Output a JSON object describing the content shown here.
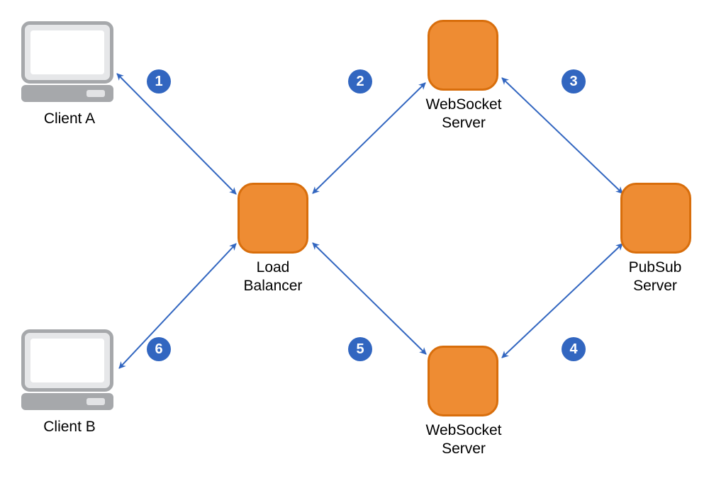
{
  "nodes": {
    "clientA": {
      "label": "Client A"
    },
    "clientB": {
      "label": "Client B"
    },
    "loadBalancer": {
      "label": "Load\nBalancer"
    },
    "wsTop": {
      "label": "WebSocket\nServer"
    },
    "wsBottom": {
      "label": "WebSocket\nServer"
    },
    "pubsub": {
      "label": "PubSub\nServer"
    }
  },
  "steps": {
    "s1": "1",
    "s2": "2",
    "s3": "3",
    "s4": "4",
    "s5": "5",
    "s6": "6"
  },
  "connections": [
    {
      "from": "clientA",
      "to": "loadBalancer",
      "bidirectional": true,
      "step": 1
    },
    {
      "from": "loadBalancer",
      "to": "wsTop",
      "bidirectional": true,
      "step": 2
    },
    {
      "from": "wsTop",
      "to": "pubsub",
      "bidirectional": true,
      "step": 3
    },
    {
      "from": "pubsub",
      "to": "wsBottom",
      "bidirectional": true,
      "step": 4
    },
    {
      "from": "wsBottom",
      "to": "loadBalancer",
      "bidirectional": true,
      "step": 5
    },
    {
      "from": "loadBalancer",
      "to": "clientB",
      "bidirectional": true,
      "step": 6
    }
  ],
  "colors": {
    "nodeFill": "#ee8c33",
    "nodeBorder": "#d86e0c",
    "arrow": "#3266c0",
    "badge": "#3266c0",
    "computerBody": "#a6a8ab",
    "computerFace": "#e6e7e9"
  }
}
